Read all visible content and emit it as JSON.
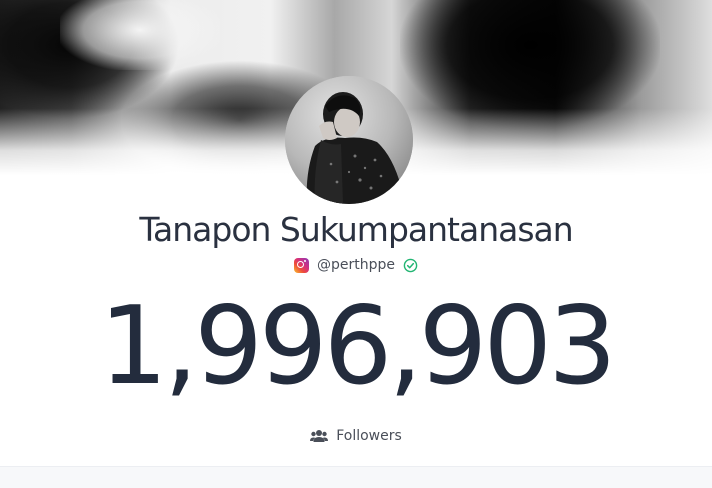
{
  "profile": {
    "name": "Tanapon Sukumpantanasan",
    "handle": "@perthppe",
    "platform_icon": "instagram-icon",
    "verified_icon": "check-circle-icon"
  },
  "stats": {
    "count": "1,996,903",
    "label": "Followers",
    "label_icon": "users-icon"
  },
  "colors": {
    "text_dark": "#232c3d",
    "verified": "#22b573"
  }
}
